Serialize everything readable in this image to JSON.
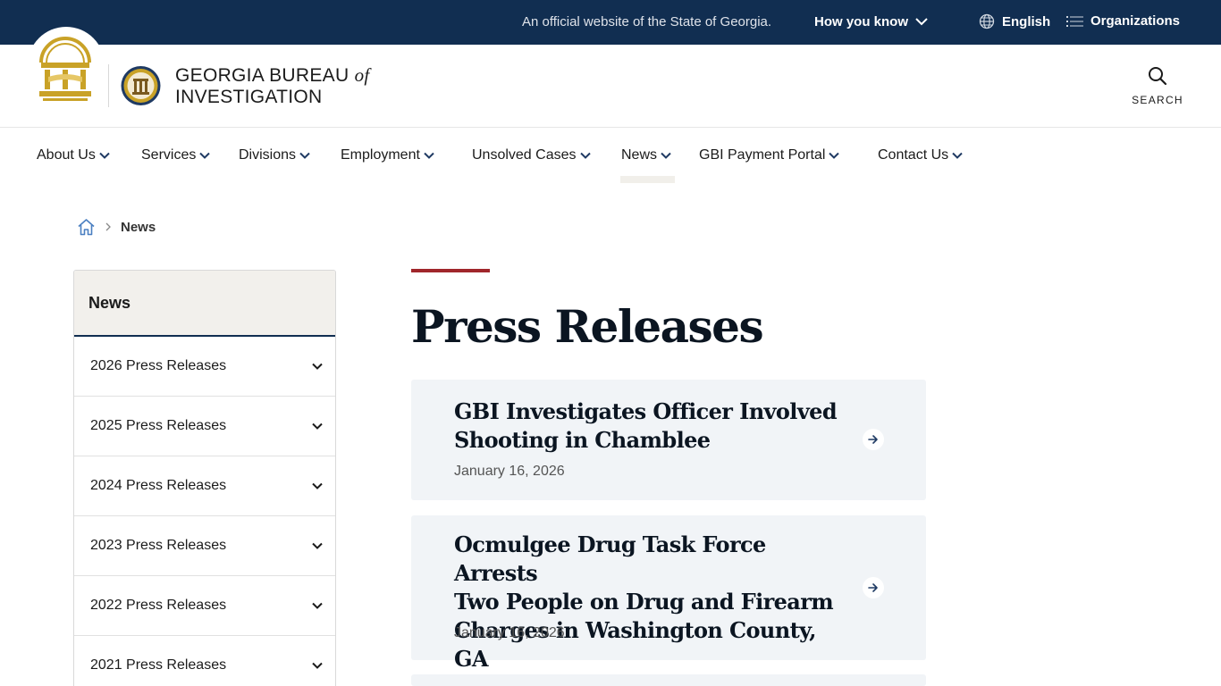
{
  "banner": {
    "official_text": "An official website of the State of Georgia.",
    "how_you_know": "How you know",
    "language": "English",
    "organizations": "Organizations"
  },
  "header": {
    "title_line1": "GEORGIA BUREAU",
    "title_of": "of",
    "title_line2": "INVESTIGATION",
    "search_label": "SEARCH"
  },
  "nav": {
    "items": [
      {
        "label": "About Us"
      },
      {
        "label": "Services"
      },
      {
        "label": "Divisions"
      },
      {
        "label": "Employment"
      },
      {
        "label": "Unsolved Cases"
      },
      {
        "label": "News"
      },
      {
        "label": "GBI Payment Portal"
      },
      {
        "label": "Contact Us"
      }
    ],
    "active": "News"
  },
  "breadcrumb": {
    "current": "News"
  },
  "sidebar": {
    "heading": "News",
    "items": [
      {
        "label": "2026 Press Releases"
      },
      {
        "label": "2025 Press Releases"
      },
      {
        "label": "2024 Press Releases"
      },
      {
        "label": "2023 Press Releases"
      },
      {
        "label": "2022 Press Releases"
      },
      {
        "label": "2021 Press Releases"
      }
    ]
  },
  "main": {
    "title": "Press Releases",
    "releases": [
      {
        "title_line1": "GBI Investigates Officer Involved",
        "title_line2": "Shooting in Chamblee",
        "date": "January 16, 2026"
      },
      {
        "title_line1": "Ocmulgee Drug Task Force Arrests",
        "title_line2": "Two People on Drug and Firearm",
        "title_line3": "Charges in Washington County, GA",
        "date": "January 16, 2026"
      }
    ]
  },
  "colors": {
    "banner_bg": "#112e51",
    "accent_red": "#a0262b",
    "card_bg": "#f1f4f7",
    "gold": "#c9a227"
  }
}
